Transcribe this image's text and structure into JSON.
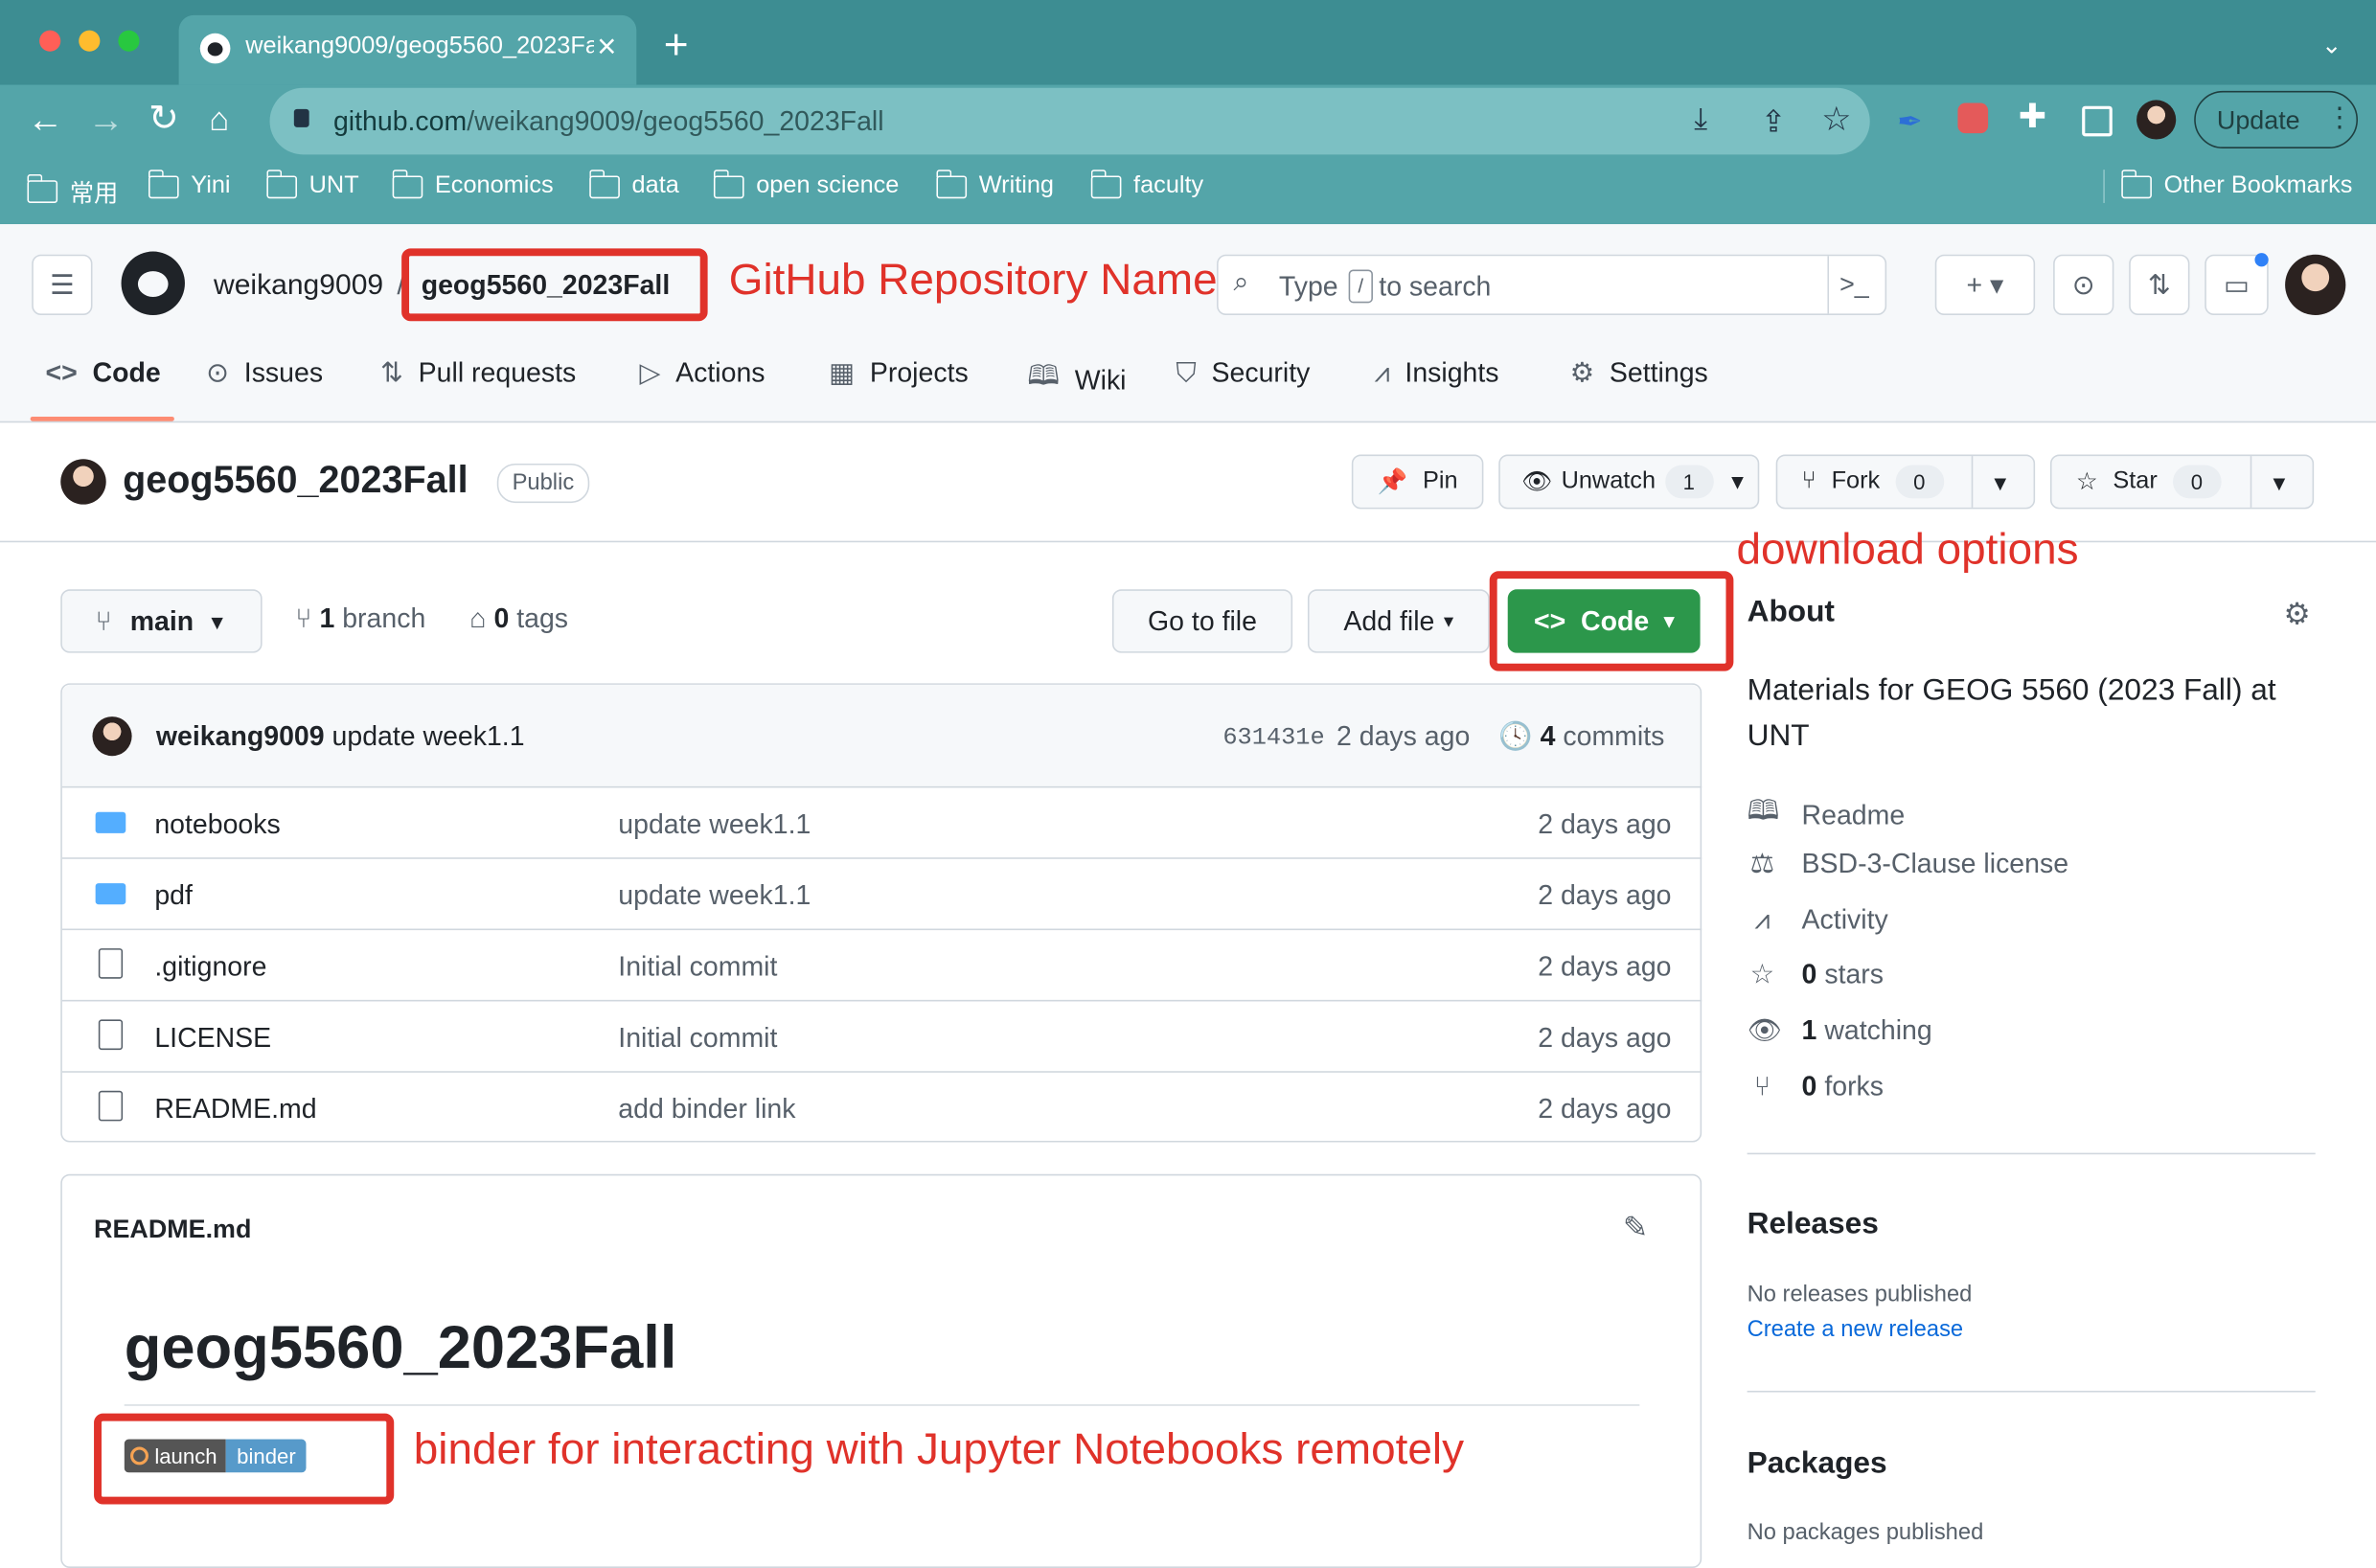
{
  "browser": {
    "tab_title": "weikang9009/geog5560_2023Fall",
    "tab_close": "×",
    "new_tab": "+",
    "url_host": "github.com",
    "url_path": "/weikang9009/geog5560_2023Fall",
    "update_label": "Update",
    "bookmarks": [
      "常用",
      "Yini",
      "UNT",
      "Economics",
      "data",
      "open science",
      "Writing",
      "faculty"
    ],
    "other_bookmarks": "Other Bookmarks"
  },
  "github": {
    "owner": "weikang9009",
    "separator": "/",
    "repo_name": "geog5560_2023Fall",
    "search_prefix": "Type",
    "search_key": "/",
    "search_suffix": "to search",
    "tabs": [
      {
        "label": "Code",
        "icon": "code-icon"
      },
      {
        "label": "Issues",
        "icon": "issue-icon"
      },
      {
        "label": "Pull requests",
        "icon": "pull-request-icon"
      },
      {
        "label": "Actions",
        "icon": "play-icon"
      },
      {
        "label": "Projects",
        "icon": "table-icon"
      },
      {
        "label": "Wiki",
        "icon": "book-icon"
      },
      {
        "label": "Security",
        "icon": "shield-icon"
      },
      {
        "label": "Insights",
        "icon": "graph-icon"
      },
      {
        "label": "Settings",
        "icon": "gear-icon"
      }
    ]
  },
  "repo": {
    "title": "geog5560_2023Fall",
    "visibility": "Public",
    "pin": "Pin",
    "unwatch": "Unwatch",
    "watch_count": "1",
    "fork": "Fork",
    "fork_count": "0",
    "star": "Star",
    "star_count": "0",
    "branch": "main",
    "branches_count": "1",
    "branches_label": "branch",
    "tags_count": "0",
    "tags_label": "tags",
    "go_to_file": "Go to file",
    "add_file": "Add file",
    "code_button": "Code"
  },
  "commit": {
    "author": "weikang9009",
    "message": "update week1.1",
    "sha": "631431e",
    "time": "2 days ago",
    "commits_count": "4",
    "commits_label": "commits"
  },
  "files": [
    {
      "name": "notebooks",
      "type": "folder",
      "message": "update week1.1",
      "time": "2 days ago"
    },
    {
      "name": "pdf",
      "type": "folder",
      "message": "update week1.1",
      "time": "2 days ago"
    },
    {
      "name": ".gitignore",
      "type": "file",
      "message": "Initial commit",
      "time": "2 days ago"
    },
    {
      "name": "LICENSE",
      "type": "file",
      "message": "Initial commit",
      "time": "2 days ago"
    },
    {
      "name": "README.md",
      "type": "file",
      "message": "add binder link",
      "time": "2 days ago"
    }
  ],
  "readme": {
    "filename": "README.md",
    "heading": "geog5560_2023Fall",
    "badge_left": "launch",
    "badge_right": "binder"
  },
  "about": {
    "title": "About",
    "description": "Materials for GEOG 5560 (2023 Fall) at UNT",
    "readme": "Readme",
    "license": "BSD-3-Clause license",
    "activity": "Activity",
    "stars_count": "0",
    "stars_label": "stars",
    "watching_count": "1",
    "watching_label": "watching",
    "forks_count": "0",
    "forks_label": "forks",
    "releases_title": "Releases",
    "no_releases": "No releases published",
    "create_release": "Create a new release",
    "packages_title": "Packages",
    "no_packages": "No packages published"
  },
  "annotations": {
    "repo_name": "GitHub Repository Name",
    "download": "download options",
    "binder": "binder for interacting with Jupyter Notebooks remotely"
  },
  "colors": {
    "chrome_tab_strip": "#3d8d92",
    "chrome_toolbar": "#54a5a9",
    "annotation_red": "#e0322a",
    "code_button_green": "#2c974b",
    "link_blue": "#0969da",
    "folder_blue": "#54aeff"
  }
}
